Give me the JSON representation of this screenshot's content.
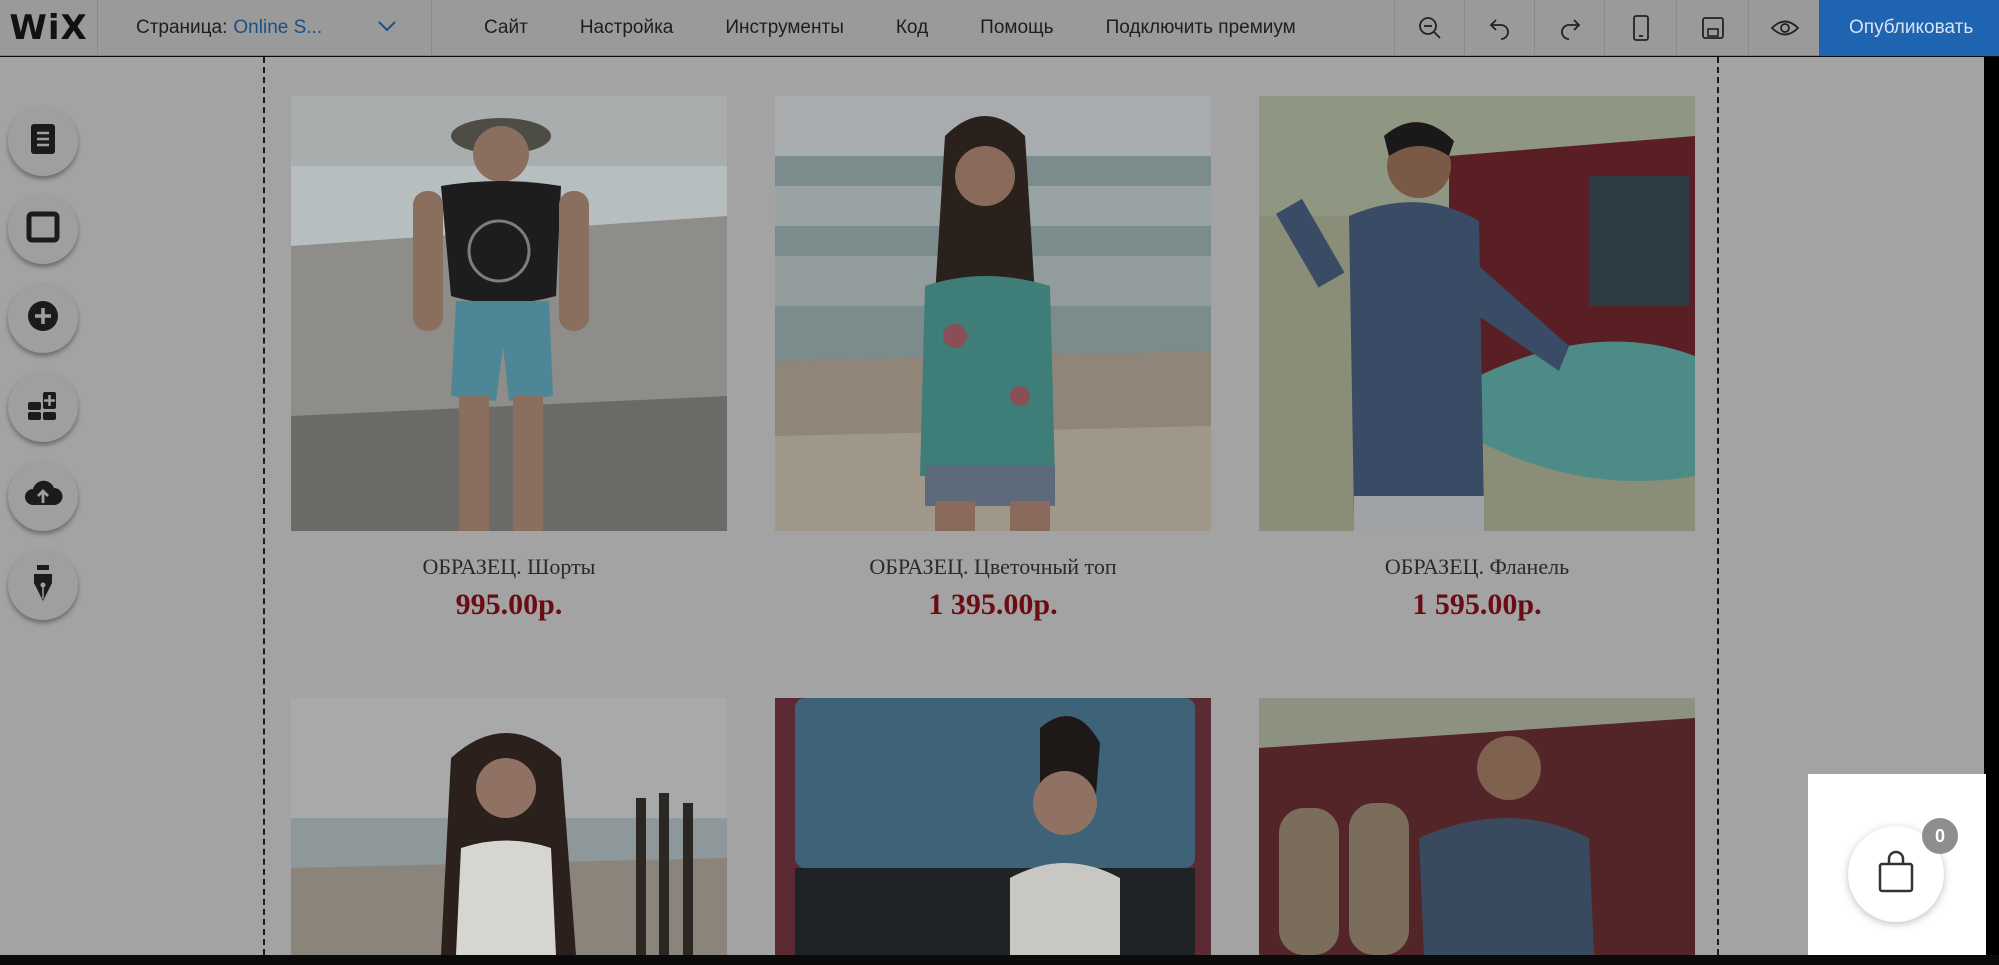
{
  "brand": {
    "logo": "WiX"
  },
  "header": {
    "page_label": "Страница:",
    "page_name": "Online S...",
    "menu": [
      "Сайт",
      "Настройка",
      "Инструменты",
      "Код",
      "Помощь",
      "Подключить премиум"
    ],
    "publish_label": "Опубликовать"
  },
  "toolbar_icons": [
    "zoom-out-icon",
    "undo-icon",
    "redo-icon",
    "mobile-icon",
    "save-icon",
    "preview-eye-icon"
  ],
  "left_tools": [
    "pages-icon",
    "background-icon",
    "add-icon",
    "apps-icon",
    "upload-icon",
    "blog-pen-icon"
  ],
  "products": [
    {
      "title": "ОБРАЗЕЦ. Шорты",
      "price": "995.00р."
    },
    {
      "title": "ОБРАЗЕЦ. Цветочный топ",
      "price": "1 395.00р."
    },
    {
      "title": "ОБРАЗЕЦ. Фланель",
      "price": "1 595.00р."
    }
  ],
  "cart": {
    "count": "0"
  },
  "colors": {
    "accent": "#1e64b0",
    "price": "#6b0c12",
    "overlay": "#a3a3a3"
  }
}
